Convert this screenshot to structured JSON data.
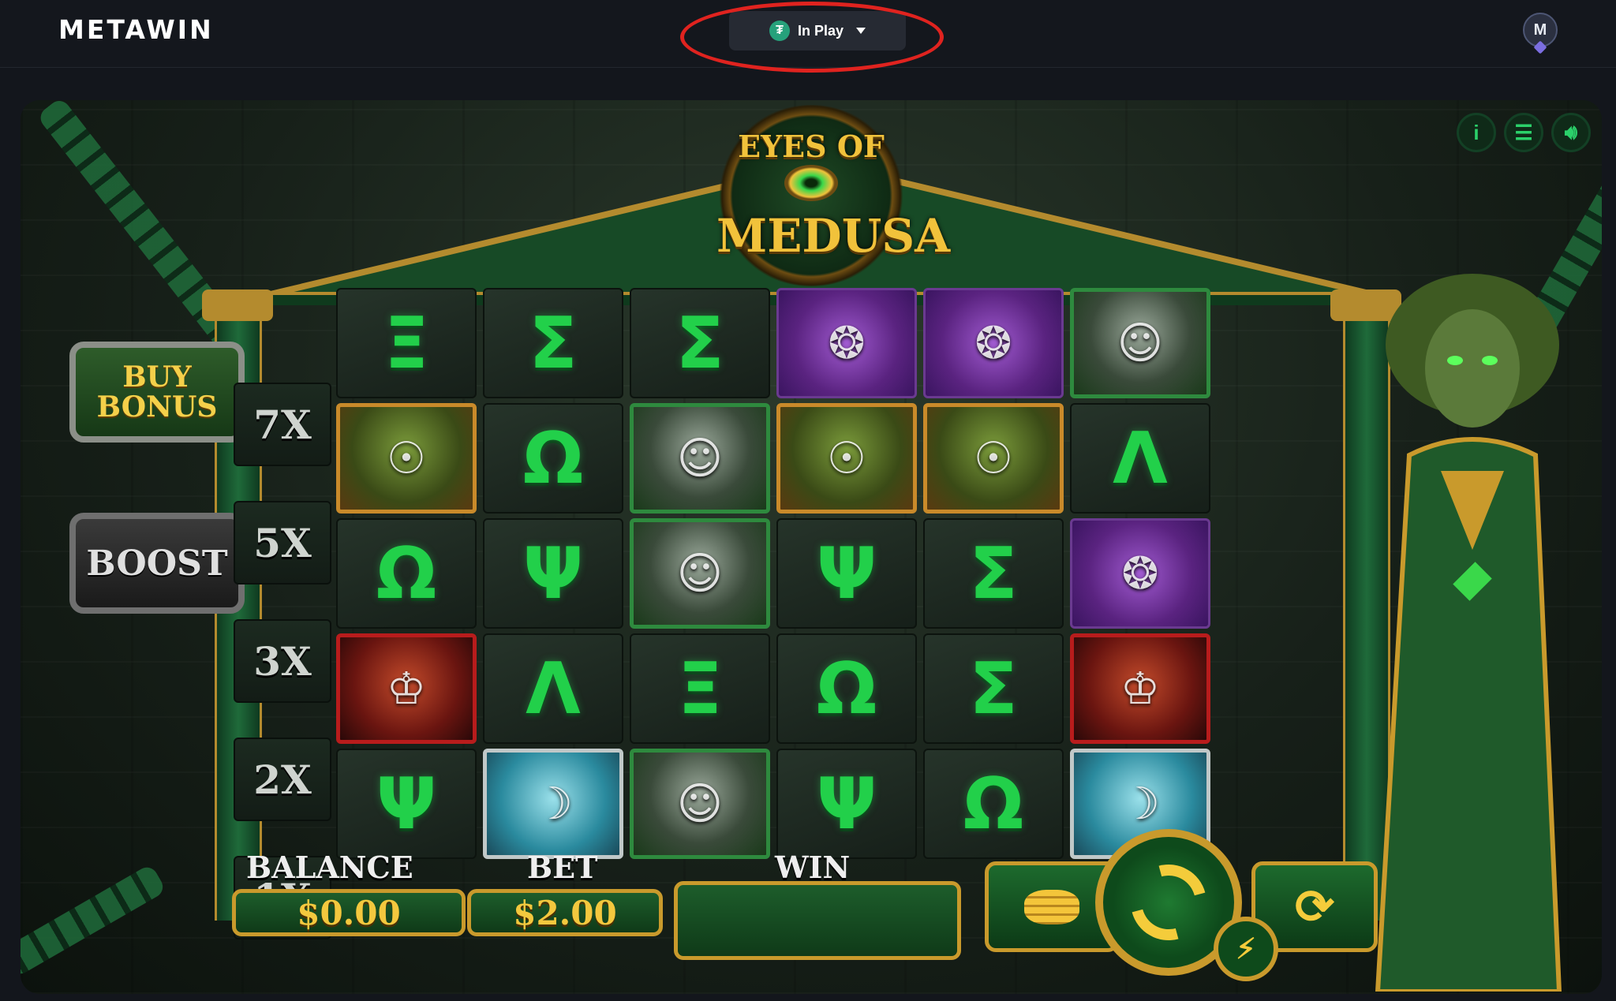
{
  "header": {
    "logo": "METAWIN",
    "currency_label": "In Play",
    "currency_icon": "tether-icon",
    "avatar_initials": "M"
  },
  "game": {
    "title_line1": "EYES OF",
    "title_line2": "MEDUSA",
    "buy_bonus_line1": "BUY",
    "buy_bonus_line2": "BONUS",
    "boost_label": "BOOST",
    "multipliers": [
      "7X",
      "5X",
      "3X",
      "2X",
      "1X"
    ],
    "controls": {
      "info_icon": "info-icon",
      "settings_icon": "settings-icon",
      "sound_icon": "sound-icon"
    },
    "balance_label": "BALANCE",
    "balance_value": "$0.00",
    "bet_label": "BET",
    "bet_value": "$2.00",
    "win_label": "WIN",
    "win_value": "",
    "reels": [
      [
        "Ξ",
        "medusa",
        "Ω",
        "king",
        "Ψ"
      ],
      [
        "Σ",
        "Ω",
        "Ψ",
        "Λ",
        "siren"
      ],
      [
        "Σ",
        "statue",
        "statue",
        "Ξ",
        "statue"
      ],
      [
        "hydra",
        "medusa",
        "Ψ",
        "Ω",
        "Ψ"
      ],
      [
        "hydra",
        "medusa",
        "Σ",
        "Σ",
        "Ω"
      ],
      [
        "statue",
        "Λ",
        "hydra",
        "king",
        "siren"
      ]
    ]
  }
}
